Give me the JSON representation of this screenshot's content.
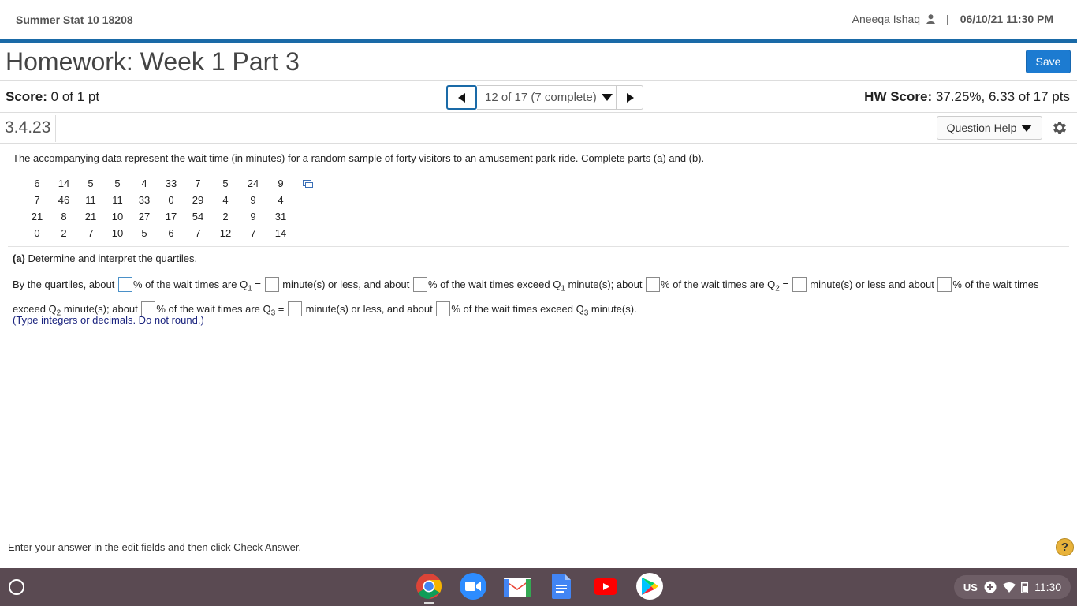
{
  "header": {
    "course": "Summer Stat 10 18208",
    "user_name": "Aneeqa Ishaq",
    "separator": "|",
    "datetime": "06/10/21 11:30 PM"
  },
  "assignment": {
    "title": "Homework: Week 1 Part 3",
    "save_label": "Save"
  },
  "score_row": {
    "score_label": "Score:",
    "score_value": " 0 of 1 pt",
    "nav_position": "12 of 17 (7 complete)",
    "hw_score_label": "HW Score:",
    "hw_score_value": " 37.25%, 6.33 of 17 pts"
  },
  "question": {
    "id": "3.4.23",
    "help_label": "Question Help",
    "intro": "The accompanying data represent the wait time (in minutes) for a random sample of forty visitors to an amusement park ride. Complete parts (a) and (b).",
    "data_rows": [
      [
        "6",
        "14",
        "5",
        "5",
        "4",
        "33",
        "7",
        "5",
        "24",
        "9"
      ],
      [
        "7",
        "46",
        "11",
        "11",
        "33",
        "0",
        "29",
        "4",
        "9",
        "4"
      ],
      [
        "21",
        "8",
        "21",
        "10",
        "27",
        "17",
        "54",
        "2",
        "9",
        "31"
      ],
      [
        "0",
        "2",
        "7",
        "10",
        "5",
        "6",
        "7",
        "12",
        "7",
        "14"
      ]
    ],
    "part_a_label": "(a)",
    "part_a_text": " Determine and interpret the quartiles.",
    "answer_text": {
      "t1": "By the quartiles, about ",
      "t2": "% of the wait times are Q",
      "t3": " = ",
      "t4": " minute(s) or less, and about ",
      "t5": "% of the wait times exceed Q",
      "t6": " minute(s); about ",
      "t7": "% of the wait times are Q",
      "t8": " = ",
      "t9": " minute(s) or less and about ",
      "t10": "% of the wait times exceed Q",
      "t11": " minute(s); about ",
      "t12": "% of the wait times are Q",
      "t13": " = ",
      "t14": " minute(s) or less, and about ",
      "t15": "% of the wait times exceed Q",
      "t16": " minute(s).",
      "sub1": "1",
      "sub2": "2",
      "sub3": "3"
    },
    "hint": "(Type integers or decimals. Do not round.)"
  },
  "footer": {
    "status": "Enter your answer in the edit fields and then click Check Answer.",
    "help_symbol": "?"
  },
  "shelf": {
    "lang": "US",
    "time": "11:30",
    "apps": [
      "chrome-icon",
      "zoom-icon",
      "gmail-icon",
      "docs-icon",
      "youtube-icon",
      "play-store-icon"
    ]
  }
}
